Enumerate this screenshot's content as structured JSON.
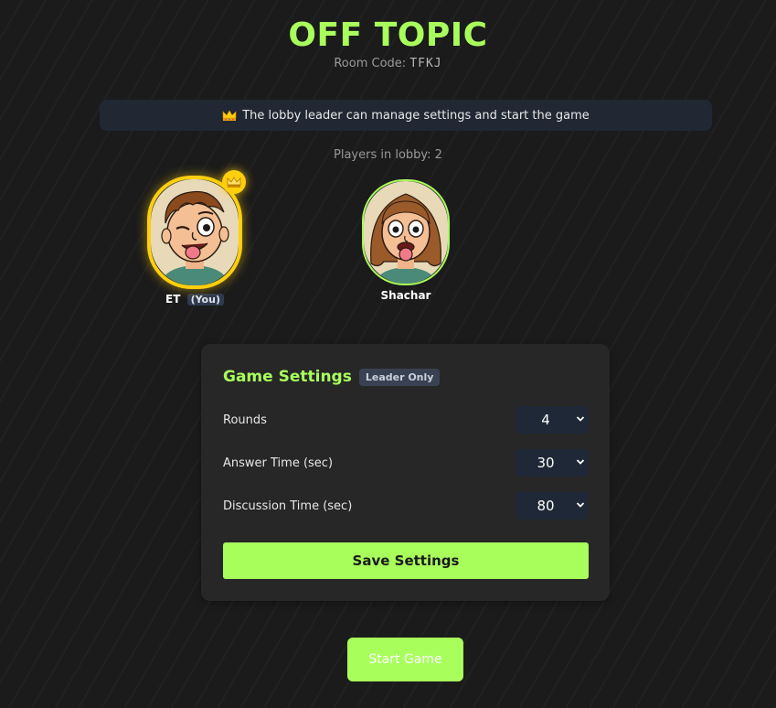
{
  "header": {
    "title": "OFF TOPIC",
    "room_code_label": "Room Code:",
    "room_code": "TFKJ"
  },
  "banner": {
    "icon": "crown-icon",
    "text": "The lobby leader can manage settings and start the game"
  },
  "lobby": {
    "players_label": "Players in lobby: 2",
    "players": [
      {
        "name": "ET",
        "tag": "(You)",
        "is_leader": true,
        "avatar": "boy-winking-tongue-out-avatar"
      },
      {
        "name": "Shachar",
        "tag": "",
        "is_leader": false,
        "avatar": "girl-tongue-out-avatar"
      }
    ]
  },
  "settings": {
    "title": "Game Settings",
    "badge": "Leader Only",
    "rows": [
      {
        "label": "Rounds",
        "value": "4"
      },
      {
        "label": "Answer Time (sec)",
        "value": "30"
      },
      {
        "label": "Discussion Time (sec)",
        "value": "80"
      }
    ],
    "save_label": "Save Settings"
  },
  "actions": {
    "start_label": "Start Game"
  },
  "colors": {
    "accent": "#a8ff5c",
    "leader_gold": "#ffcf0d",
    "background": "#1b1b1b",
    "card": "#272727"
  }
}
